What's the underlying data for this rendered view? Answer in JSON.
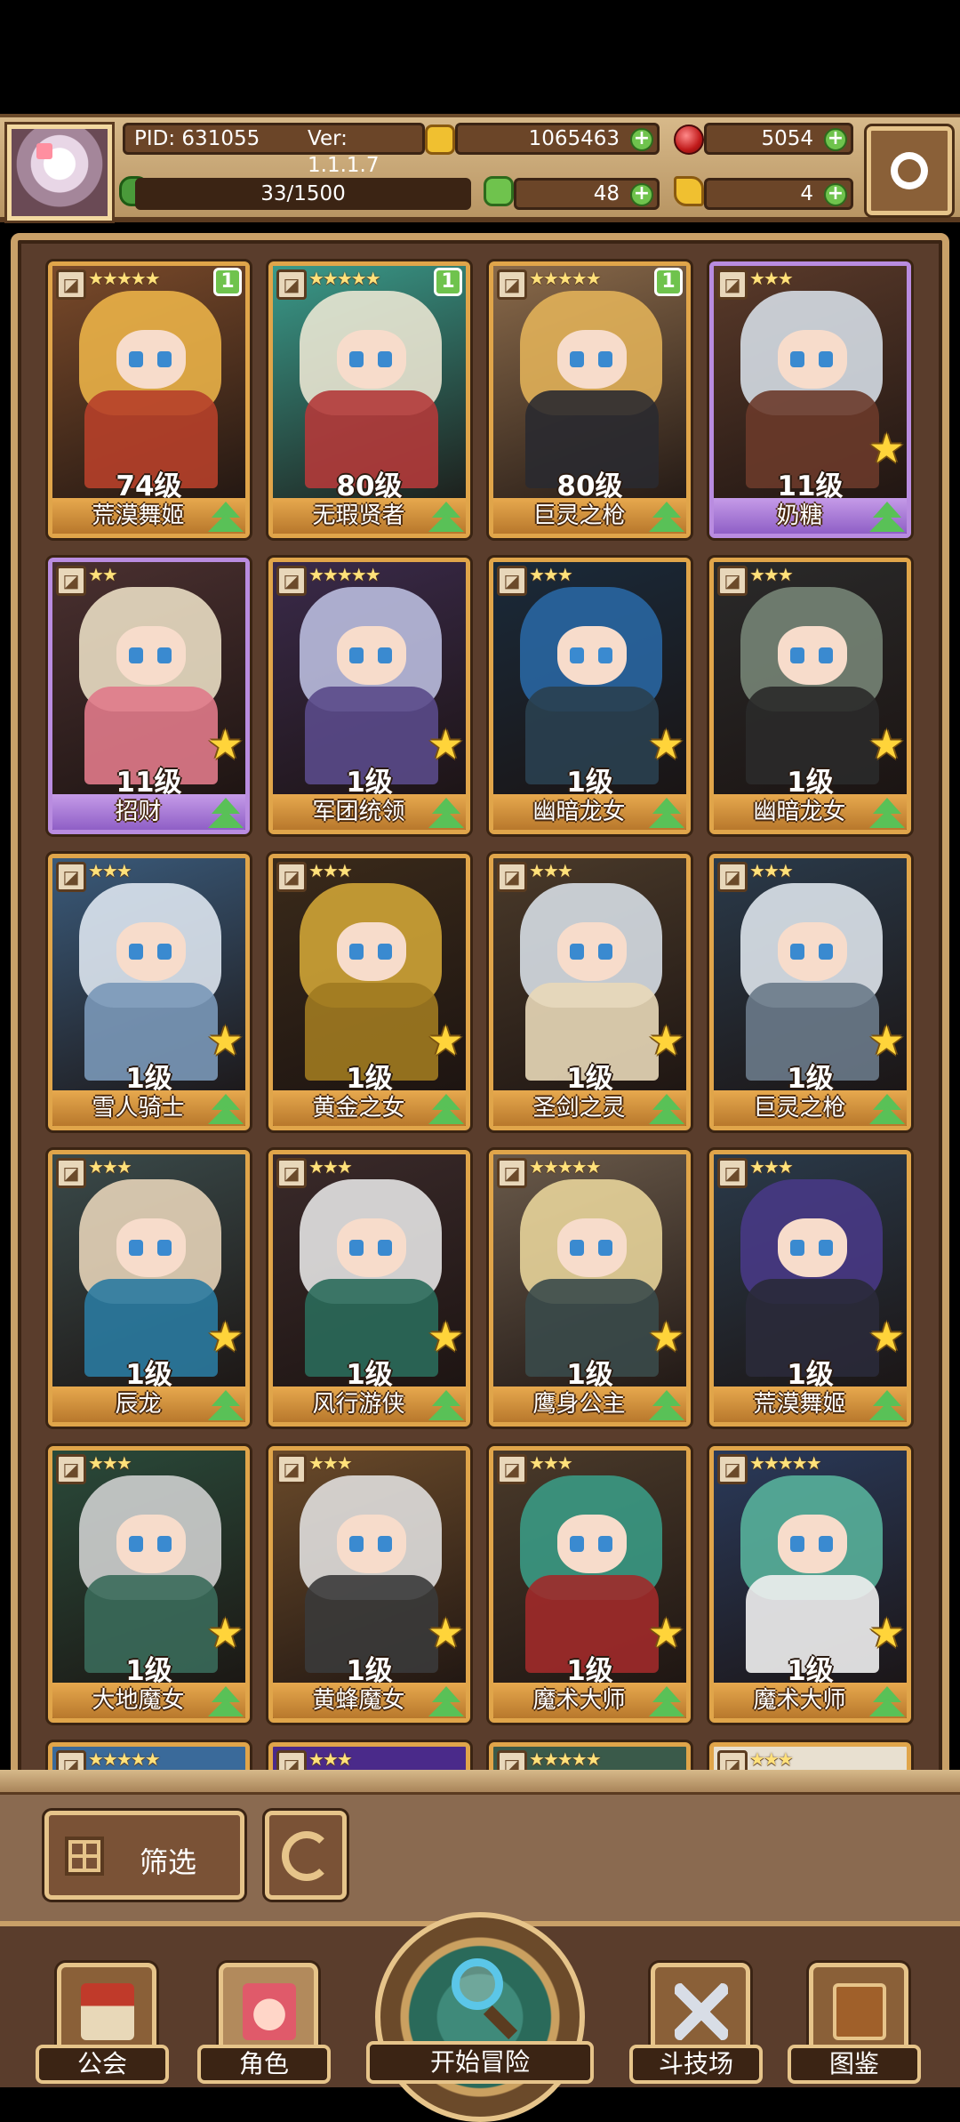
{
  "header": {
    "pid": "PID: 631055",
    "version": "Ver: 1.1.1.7",
    "gold": "1065463",
    "gems": "5054",
    "exp": "33/1500",
    "clover": "48",
    "keys": "4"
  },
  "cards": [
    {
      "level": "74级",
      "name": "荒漠舞姬",
      "stars": "★★★★★",
      "badge": "1",
      "frame": "gold",
      "hair": "#f2b84a",
      "outfit": "#b6402a",
      "bg": "#7a4a2a",
      "elem": "◪"
    },
    {
      "level": "80级",
      "name": "无瑕贤者",
      "stars": "★★★★★",
      "badge": "1",
      "frame": "gold",
      "hair": "#f3ecd8",
      "outfit": "#b23a3a",
      "bg": "#3a9a8a",
      "elem": "◪"
    },
    {
      "level": "80级",
      "name": "巨灵之枪",
      "stars": "★★★★★",
      "badge": "1",
      "frame": "gold",
      "hair": "#e7b65a",
      "outfit": "#2a2a30",
      "bg": "#8a6a4a",
      "elem": "◪"
    },
    {
      "level": "11级",
      "name": "奶糖",
      "stars": "★★★",
      "badge": "",
      "frame": "purple",
      "hair": "#dde6f0",
      "outfit": "#6a3a2a",
      "bg": "#5a3a2a",
      "elem": "◪",
      "star_badge": true
    },
    {
      "level": "11级",
      "name": "招财",
      "stars": "★★",
      "badge": "",
      "frame": "purple",
      "hair": "#f3e7cc",
      "outfit": "#e07a8a",
      "bg": "#4a3030",
      "elem": "◪",
      "star_badge": true
    },
    {
      "level": "1级",
      "name": "军团统领",
      "stars": "★★★★★",
      "badge": "",
      "frame": "gold",
      "hair": "#c2c6e8",
      "outfit": "#5a4a8a",
      "bg": "#3a2a4a",
      "elem": "◪",
      "star_badge": true
    },
    {
      "level": "1级",
      "name": "幽暗龙女",
      "stars": "★★★",
      "badge": "",
      "frame": "gold",
      "hair": "#2a6aa8",
      "outfit": "#2a4050",
      "bg": "#1a2a3a",
      "elem": "◪",
      "star_badge": true
    },
    {
      "level": "1级",
      "name": "幽暗龙女",
      "stars": "★★★",
      "badge": "",
      "frame": "gold",
      "hair": "#7a8a7a",
      "outfit": "#2a2a2a",
      "bg": "#2a2a2a",
      "elem": "◪",
      "star_badge": true
    },
    {
      "level": "1级",
      "name": "雪人骑士",
      "stars": "★★★",
      "badge": "",
      "frame": "gold",
      "hair": "#e6eef8",
      "outfit": "#7a98b8",
      "bg": "#3a5a7a",
      "elem": "◪",
      "star_badge": true
    },
    {
      "level": "1级",
      "name": "黄金之女",
      "stars": "★★★",
      "badge": "",
      "frame": "gold",
      "hair": "#d8ac38",
      "outfit": "#a07a20",
      "bg": "#3a2a1a",
      "elem": "◪",
      "star_badge": true
    },
    {
      "level": "1级",
      "name": "圣剑之灵",
      "stars": "★★★",
      "badge": "",
      "frame": "gold",
      "hair": "#dfe8f0",
      "outfit": "#e8d8b8",
      "bg": "#4a3a2a",
      "elem": "◪",
      "star_badge": true
    },
    {
      "level": "1级",
      "name": "巨灵之枪",
      "stars": "★★★",
      "badge": "",
      "frame": "gold",
      "hair": "#e8eef6",
      "outfit": "#6a7a8a",
      "bg": "#2a3a4a",
      "elem": "◪",
      "star_badge": true
    },
    {
      "level": "1级",
      "name": "辰龙",
      "stars": "★★★",
      "badge": "",
      "frame": "gold",
      "hair": "#f0dcc0",
      "outfit": "#2a7aa0",
      "bg": "#3a4a4a",
      "elem": "◪",
      "star_badge": true
    },
    {
      "level": "1级",
      "name": "风行游侠",
      "stars": "★★★",
      "badge": "",
      "frame": "gold",
      "hair": "#eeeeee",
      "outfit": "#2a6a5a",
      "bg": "#3a2a2a",
      "elem": "◪",
      "star_badge": true
    },
    {
      "level": "1级",
      "name": "鹰身公主",
      "stars": "★★★★★",
      "badge": "",
      "frame": "gold",
      "hair": "#f0dca0",
      "outfit": "#3a4a4a",
      "bg": "#6a5a4a",
      "elem": "◪",
      "star_badge": true
    },
    {
      "level": "1级",
      "name": "荒漠舞姬",
      "stars": "★★★",
      "badge": "",
      "frame": "gold",
      "hair": "#4a3a8a",
      "outfit": "#2a2a3a",
      "bg": "#2a3a4a",
      "elem": "◪",
      "star_badge": true
    },
    {
      "level": "1级",
      "name": "大地魔女",
      "stars": "★★★",
      "badge": "",
      "frame": "gold",
      "hair": "#d8d8d8",
      "outfit": "#3a6a5a",
      "bg": "#2a4a3a",
      "elem": "◪",
      "star_badge": true
    },
    {
      "level": "1级",
      "name": "黄蜂魔女",
      "stars": "★★★",
      "badge": "",
      "frame": "gold",
      "hair": "#e8e8e8",
      "outfit": "#3a3a3a",
      "bg": "#6a4a2a",
      "elem": "◪",
      "star_badge": true
    },
    {
      "level": "1级",
      "name": "魔术大师",
      "stars": "★★★",
      "badge": "",
      "frame": "gold",
      "hair": "#3aa08a",
      "outfit": "#a02a2a",
      "bg": "#4a3a2a",
      "elem": "◪",
      "star_badge": true
    },
    {
      "level": "1级",
      "name": "魔术大师",
      "stars": "★★★★★",
      "badge": "",
      "frame": "gold",
      "hair": "#5ab8a0",
      "outfit": "#f0f0f0",
      "bg": "#2a3a5a",
      "elem": "◪",
      "star_badge": true
    }
  ],
  "partial_row": [
    {
      "stars": "★★★★★",
      "bg": "#3a6a9a"
    },
    {
      "stars": "★★★",
      "bg": "#4a2a8a"
    },
    {
      "stars": "★★★★★",
      "bg": "#3a5a4a"
    },
    {
      "stars": "★★★",
      "bg": "#e8e0d0"
    }
  ],
  "controls": {
    "filter_label": "筛选"
  },
  "nav": {
    "guild": "公会",
    "characters": "角色",
    "adventure": "开始冒险",
    "arena": "斗技场",
    "codex": "图鉴"
  },
  "colors": {
    "accent_gold": "#e6c48a",
    "panel_brown": "#5a3d2c",
    "plus_green": "#6fc34d",
    "purple_frame": "#b98ce0"
  }
}
